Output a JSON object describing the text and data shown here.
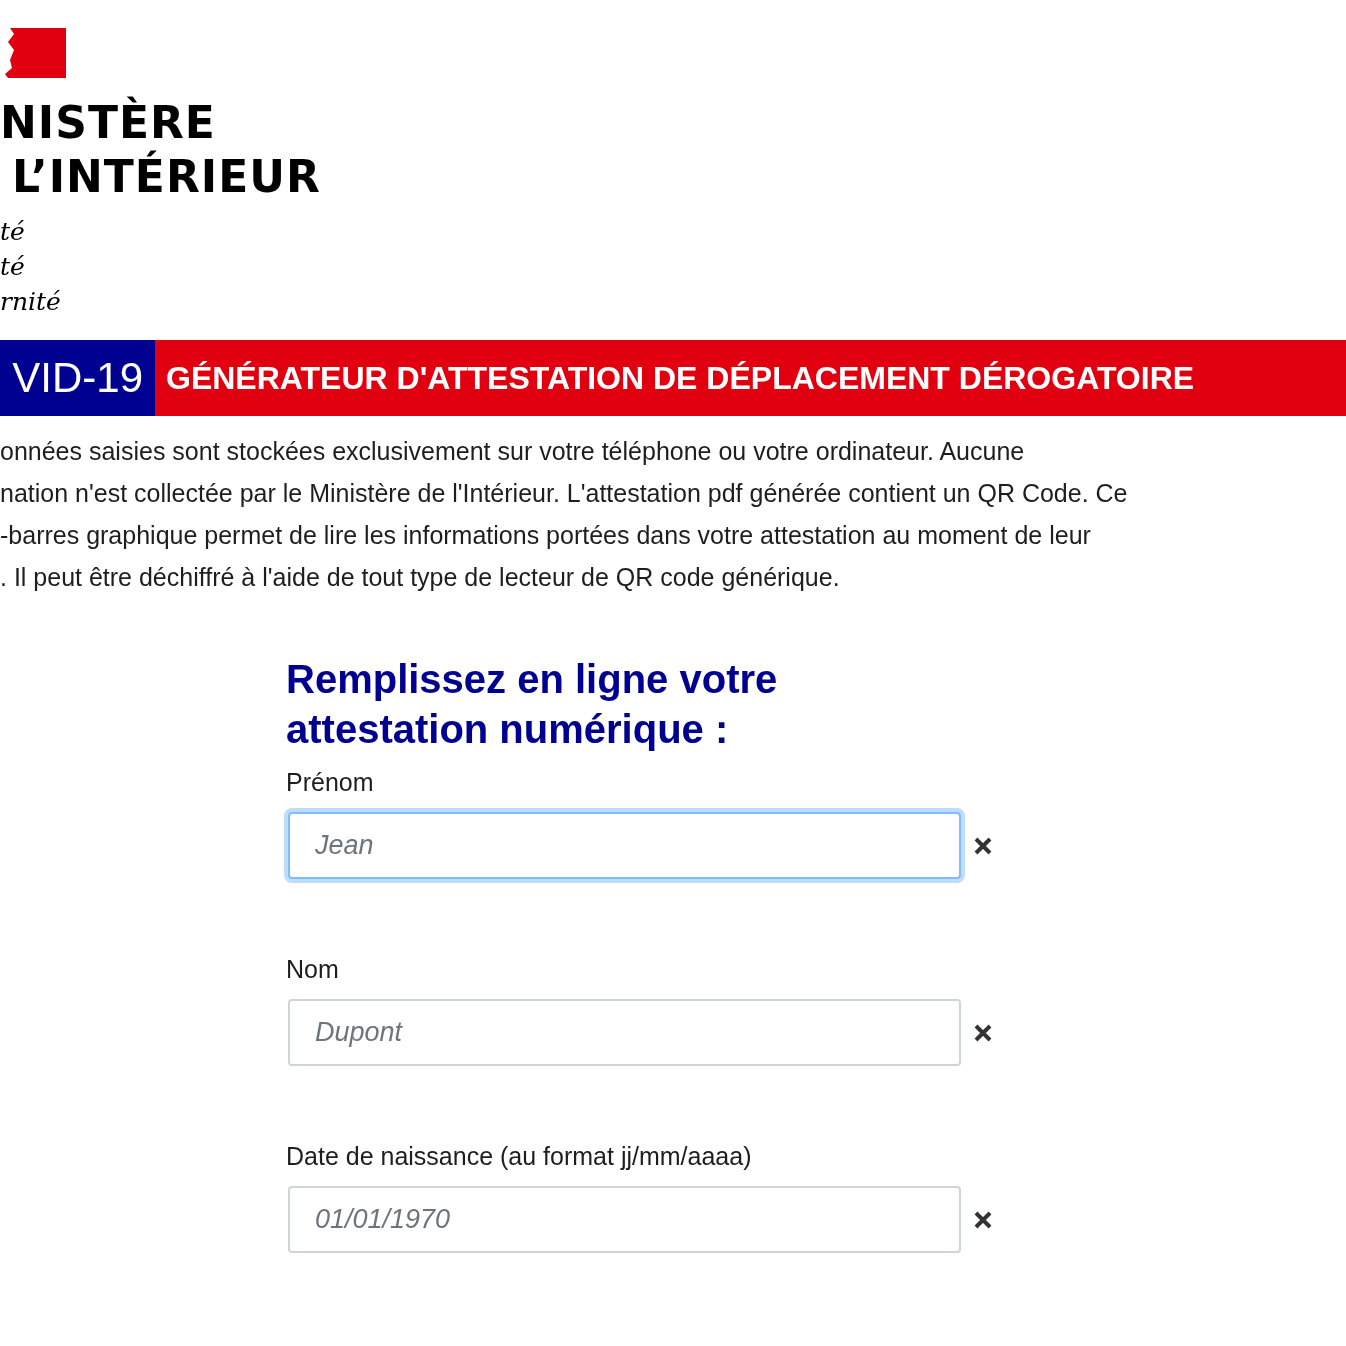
{
  "logo": {
    "title_lines": [
      "NISTÈRE",
      "L’INTÉRIEUR"
    ],
    "motto_lines": [
      "té",
      "té",
      "rnité"
    ]
  },
  "banner": {
    "tag": "VID-19",
    "title": "GÉNÉRATEUR D'ATTESTATION DE DÉPLACEMENT DÉROGATOIRE"
  },
  "notice_lines": [
    "onnées saisies sont stockées exclusivement sur votre téléphone ou votre ordinateur. Aucune",
    "nation n'est collectée par le Ministère de l'Intérieur. L'attestation pdf générée contient un QR Code. Ce",
    "-barres graphique permet de lire les informations portées dans votre attestation au moment de leur",
    ". Il peut être déchiffré à l'aide de tout type de lecteur de QR code générique."
  ],
  "form": {
    "heading": "Remplissez en ligne votre attestation numérique :",
    "fields": [
      {
        "label": "Prénom",
        "placeholder": "Jean",
        "focused": true
      },
      {
        "label": "Nom",
        "placeholder": "Dupont",
        "focused": false
      },
      {
        "label": "Date de naissance (au format jj/mm/aaaa)",
        "placeholder": "01/01/1970",
        "focused": false
      }
    ]
  }
}
